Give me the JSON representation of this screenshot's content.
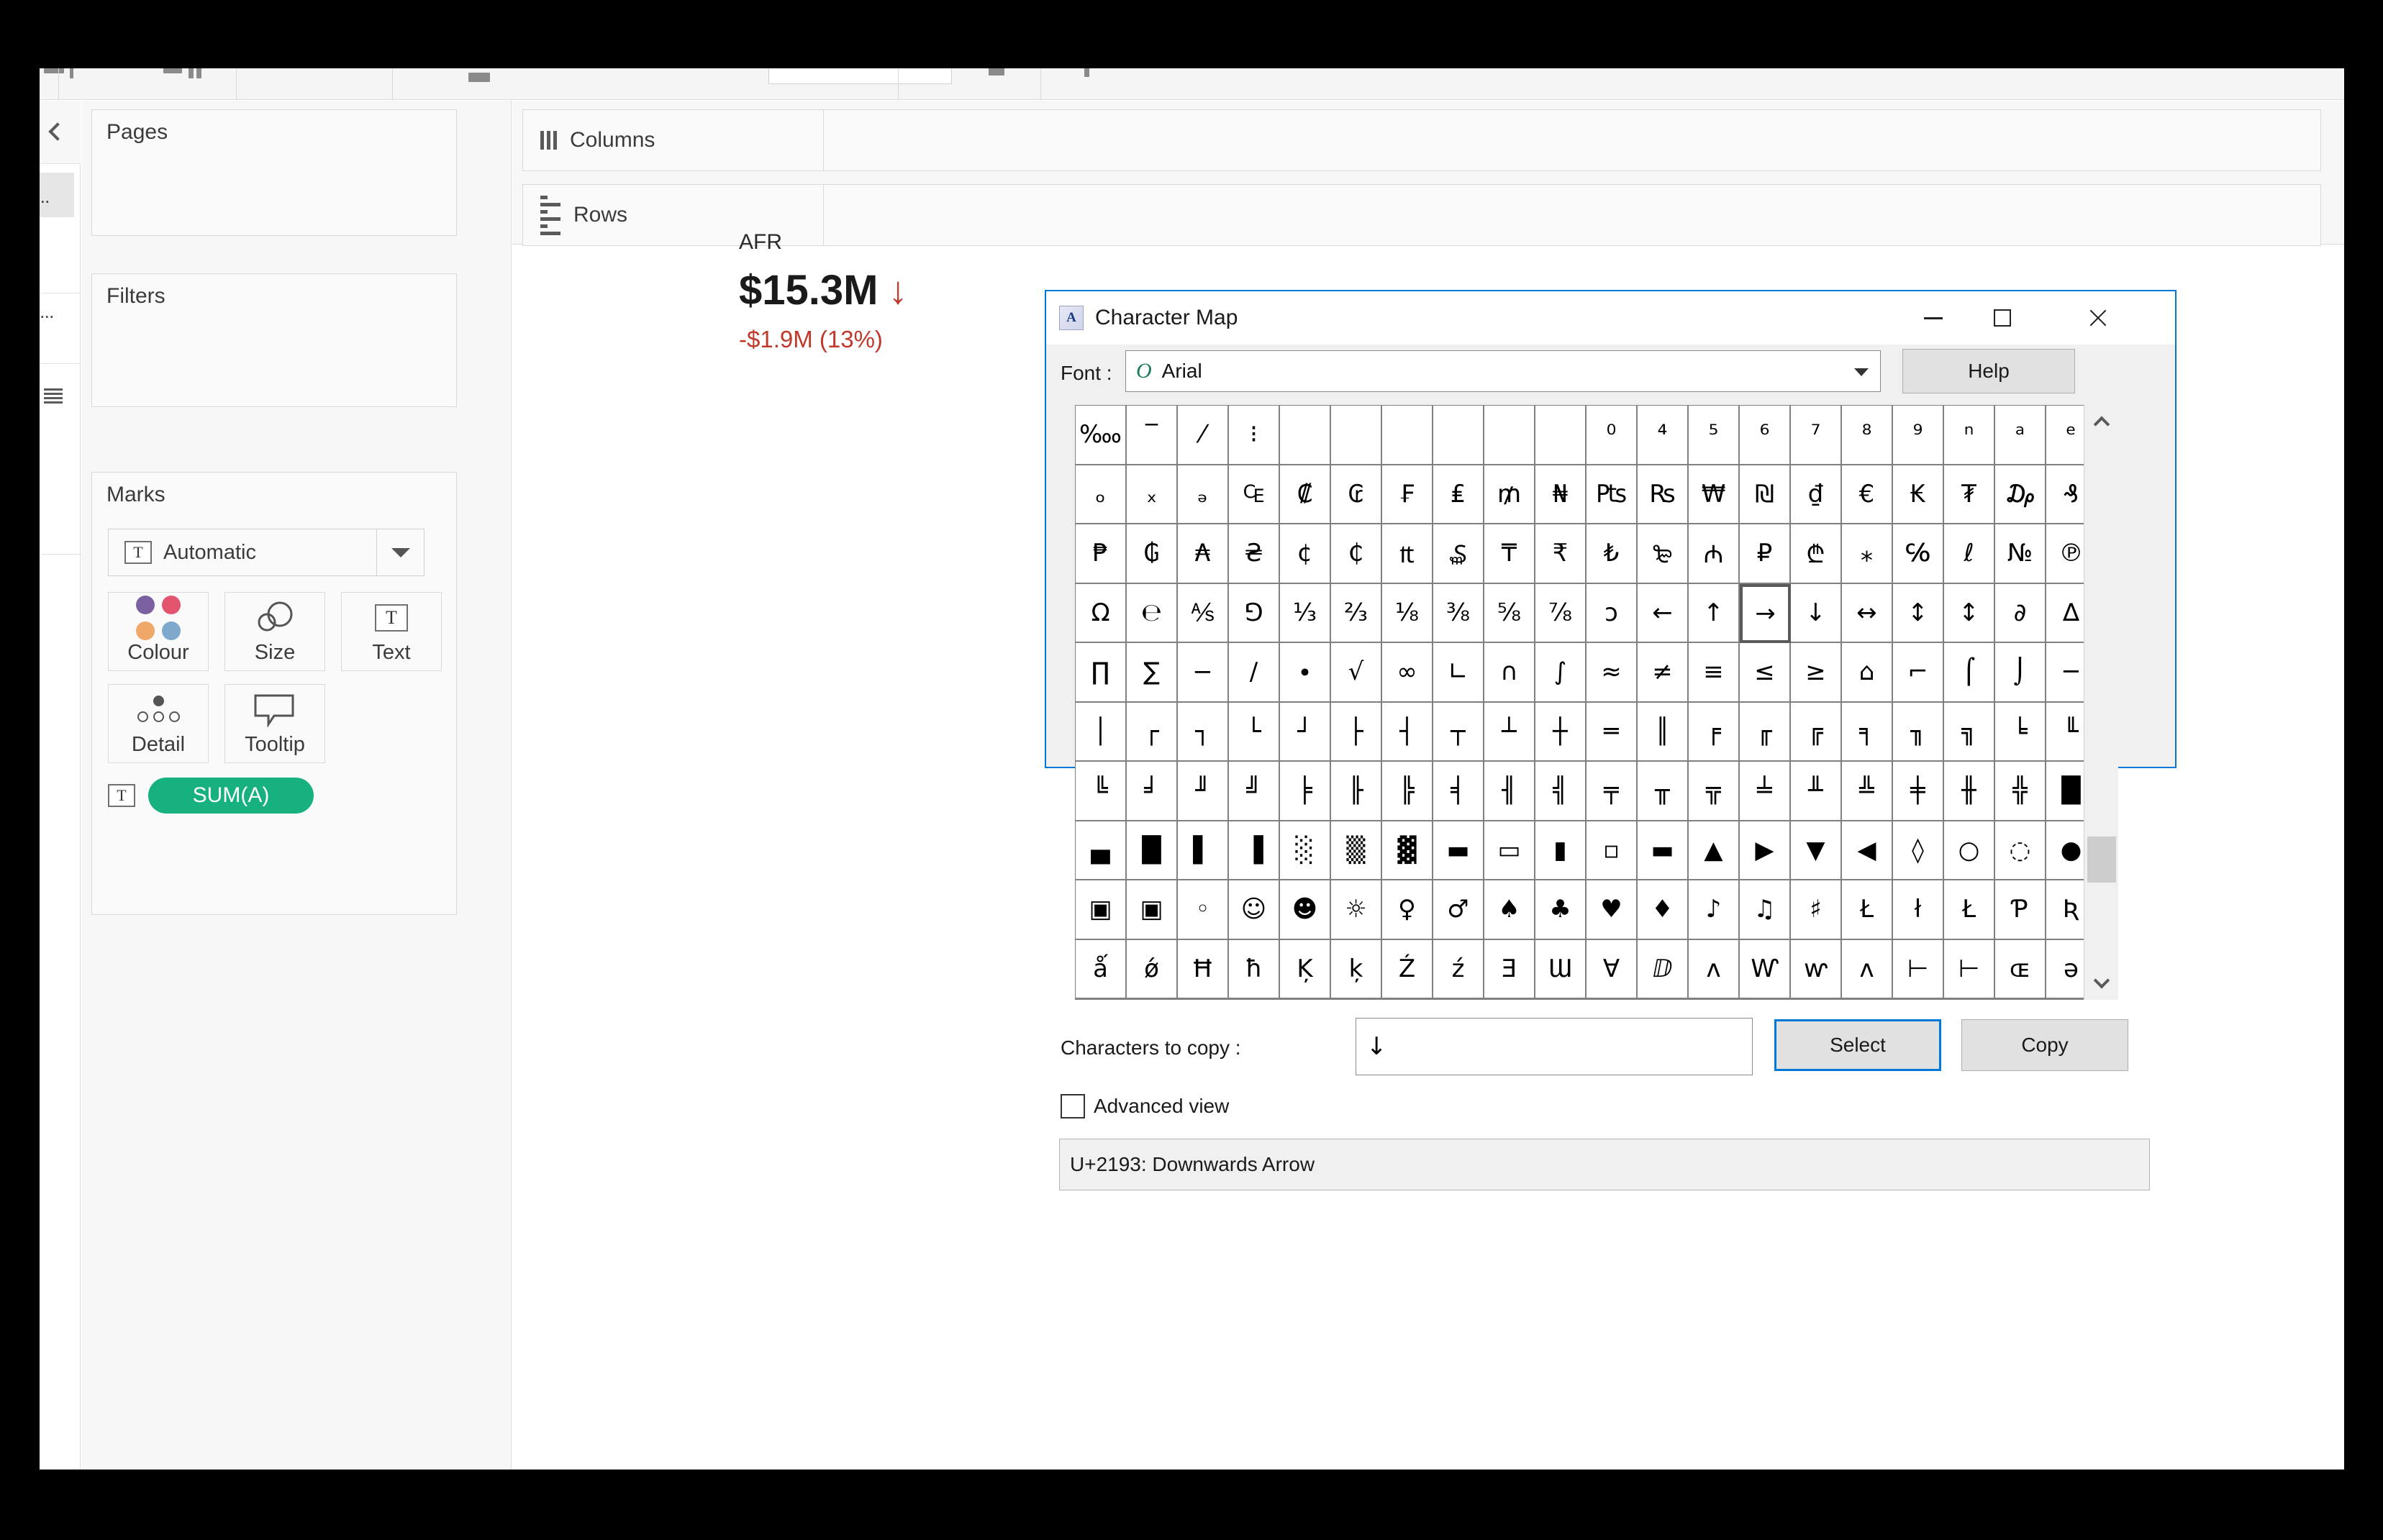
{
  "app": {
    "left_rail": {
      "collapse_icon": "chevron-left-icon",
      "entries": [
        "...",
        "e...",
        "list-icon"
      ]
    },
    "shelves": {
      "pages_label": "Pages",
      "filters_label": "Filters",
      "marks_label": "Marks",
      "columns_label": "Columns",
      "rows_label": "Rows"
    },
    "marks": {
      "type_label": "Automatic",
      "type_icon": "text-mark-icon",
      "dropdown_icon": "chevron-down-icon",
      "buttons": [
        {
          "label": "Colour",
          "icon": "colour-dots-icon"
        },
        {
          "label": "Size",
          "icon": "size-circles-icon"
        },
        {
          "label": "Text",
          "icon": "text-box-icon"
        },
        {
          "label": "Detail",
          "icon": "detail-dots-icon"
        },
        {
          "label": "Tooltip",
          "icon": "tooltip-bubble-icon"
        }
      ],
      "colour_swatches": [
        "#7b61a0",
        "#e3556f",
        "#f0a868",
        "#7fa8cd"
      ],
      "pill": {
        "label": "SUM(A)",
        "icon": "text-mark-icon",
        "colour": "#17b07f"
      }
    },
    "kpi": {
      "title": "AFR",
      "value": "$15.3M",
      "trend_arrow": "↓",
      "trend_arrow_name": "down-arrow-icon",
      "delta": "-$1.9M (13%)",
      "delta_colour": "#c0392b"
    }
  },
  "charmap": {
    "title": "Character Map",
    "app_icon": "character-map-icon",
    "window_buttons": {
      "minimize": "minimize-icon",
      "maximize": "maximize-icon",
      "close": "close-icon"
    },
    "font_label": "Font :",
    "font_value": "Arial",
    "font_otf_glyph": "O",
    "help_label": "Help",
    "copy_label": "Characters to copy :",
    "copy_value": "↓",
    "select_label": "Select",
    "copy_button_label": "Copy",
    "advanced_view_label": "Advanced view",
    "advanced_view_checked": false,
    "status_text": "U+2193: Downwards Arrow",
    "selected_index": 73,
    "scrollbar": {
      "up_icon": "chevron-up-icon",
      "down_icon": "chevron-down-icon"
    },
    "grid_rows": [
      [
        "‱",
        "‾",
        "⁄",
        "⁝",
        "",
        "",
        "",
        "",
        "",
        "",
        "⁰",
        "⁴",
        "⁵",
        "⁶",
        "⁷",
        "⁸",
        "⁹",
        "ⁿ",
        "ᵃ",
        "ᵉ"
      ],
      [
        "ₒ",
        "ₓ",
        "ₔ",
        "₠",
        "₡",
        "₢",
        "₣",
        "₤",
        "₥",
        "₦",
        "₧",
        "₨",
        "₩",
        "₪",
        "₫",
        "€",
        "₭",
        "₮",
        "₯",
        "₰"
      ],
      [
        "₱",
        "₲",
        "₳",
        "₴",
        "¢",
        "₵",
        "₶",
        "₷",
        "₸",
        "₹",
        "₺",
        "₻",
        "₼",
        "₽",
        "₾",
        "⁎",
        "℅",
        "ℓ",
        "№",
        "℗"
      ],
      [
        "Ω",
        "℮",
        "⅍",
        "⅁",
        "⅓",
        "⅔",
        "⅛",
        "⅜",
        "⅝",
        "⅞",
        "ↄ",
        "←",
        "↑",
        "→",
        "↓",
        "↔",
        "↕",
        "↕",
        "∂",
        "∆"
      ],
      [
        "∏",
        "∑",
        "−",
        "∕",
        "∙",
        "√",
        "∞",
        "∟",
        "∩",
        "∫",
        "≈",
        "≠",
        "≡",
        "≤",
        "≥",
        "⌂",
        "⌐",
        "⌠",
        "⌡",
        "─"
      ],
      [
        "│",
        "┌",
        "┐",
        "└",
        "┘",
        "├",
        "┤",
        "┬",
        "┴",
        "┼",
        "═",
        "║",
        "╒",
        "╓",
        "╔",
        "╕",
        "╖",
        "╗",
        "╘",
        "╙"
      ],
      [
        "╚",
        "╛",
        "╜",
        "╝",
        "╞",
        "╟",
        "╠",
        "╡",
        "╢",
        "╣",
        "╤",
        "╥",
        "╦",
        "╧",
        "╨",
        "╩",
        "╪",
        "╫",
        "╬",
        "█"
      ],
      [
        "▄",
        "█",
        "▌",
        "▐",
        "░",
        "▒",
        "▓",
        "▬",
        "▭",
        "▮",
        "▫",
        "▬",
        "▲",
        "▶",
        "▼",
        "◀",
        "◊",
        "○",
        "◌",
        "●"
      ],
      [
        "▣",
        "▣",
        "◦",
        "☺",
        "☻",
        "☼",
        "♀",
        "♂",
        "♠",
        "♣",
        "♥",
        "♦",
        "♪",
        "♫",
        "♯",
        "Ł",
        "ł",
        "Ł",
        "Ƥ",
        "Ʀ"
      ],
      [
        "ǻ",
        "ǿ",
        "Ħ",
        "ħ",
        "Ķ",
        "ķ",
        "Ź",
        "ź",
        "Ǝ",
        "Ɯ",
        "∀",
        "ⅅ",
        "ʌ",
        "Ⱳ",
        "ⱳ",
        "ʌ",
        "⊢",
        "⊢",
        "ɶ",
        "ə"
      ]
    ],
    "grid_columns": 20
  }
}
